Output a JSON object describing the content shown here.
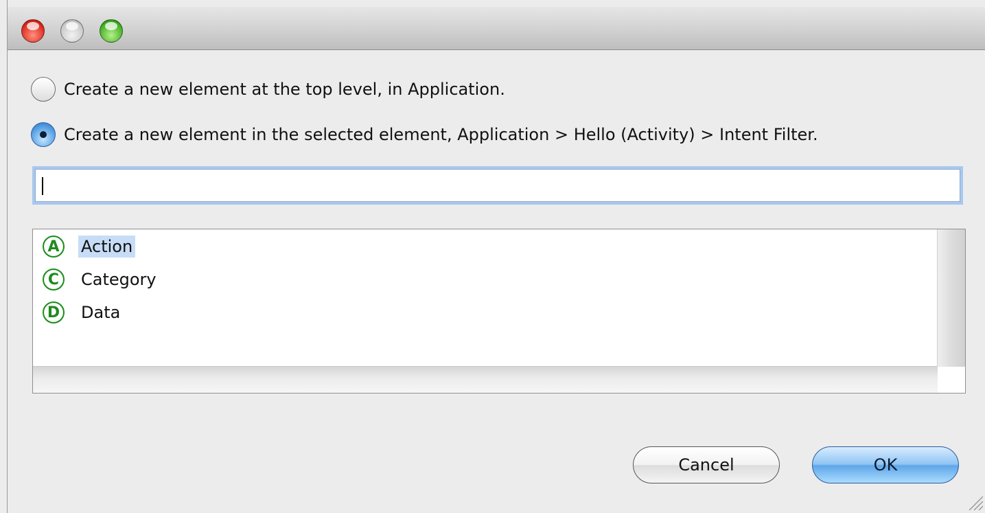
{
  "window": {
    "controls": [
      "close",
      "minimize",
      "zoom"
    ]
  },
  "options": [
    {
      "label": "Create a new element at the top level, in Application.",
      "selected": false
    },
    {
      "label": "Create a new element in the selected element, Application > Hello (Activity) > Intent Filter.",
      "selected": true
    }
  ],
  "filter": {
    "value": "",
    "placeholder": ""
  },
  "elements": [
    {
      "icon_letter": "A",
      "label": "Action",
      "selected": true
    },
    {
      "icon_letter": "C",
      "label": "Category",
      "selected": false
    },
    {
      "icon_letter": "D",
      "label": "Data",
      "selected": false
    }
  ],
  "buttons": {
    "cancel_label": "Cancel",
    "ok_label": "OK"
  },
  "colors": {
    "icon_green": "#1f8a1f",
    "selection": "#c7dcf6",
    "focus_ring": "#a9c8ee"
  }
}
